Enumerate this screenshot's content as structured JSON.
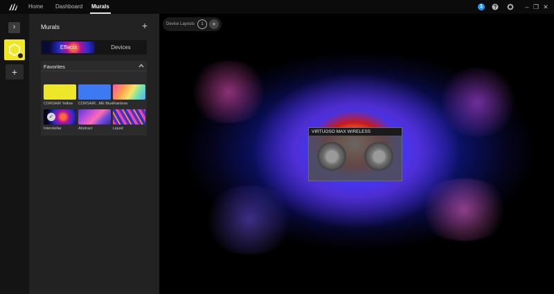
{
  "topbar": {
    "nav": [
      "Home",
      "Dashboard",
      "Murals"
    ],
    "active": "Murals",
    "notification_count": "1",
    "icons": [
      "corsair-logo-icon",
      "notification-icon",
      "help-icon",
      "settings-icon",
      "minimize-icon",
      "restore-icon",
      "close-icon"
    ],
    "window": {
      "minimize": "–",
      "restore": "❐",
      "close": "✕"
    }
  },
  "rail": {
    "expand": "›",
    "add": "+",
    "selected_mural_color": "#f0e622"
  },
  "panel": {
    "title": "Murals",
    "add": "+",
    "tabs": [
      {
        "label": "Effects",
        "active": true
      },
      {
        "label": "Devices",
        "active": false
      }
    ],
    "favorites": {
      "title": "Favorites",
      "items": [
        {
          "label": "CORSAIR Yellow"
        },
        {
          "label": "CORSAIR...ME Blue"
        },
        {
          "label": "Rainbow"
        },
        {
          "label": "Interstellar",
          "selected": true
        },
        {
          "label": "Abstract"
        },
        {
          "label": "Liquid"
        }
      ]
    }
  },
  "main": {
    "device_layouts": {
      "label": "Device Layouts",
      "current": "1",
      "add": "+"
    },
    "device": {
      "name": "VIRTUOSO MAX WIRELESS"
    }
  }
}
